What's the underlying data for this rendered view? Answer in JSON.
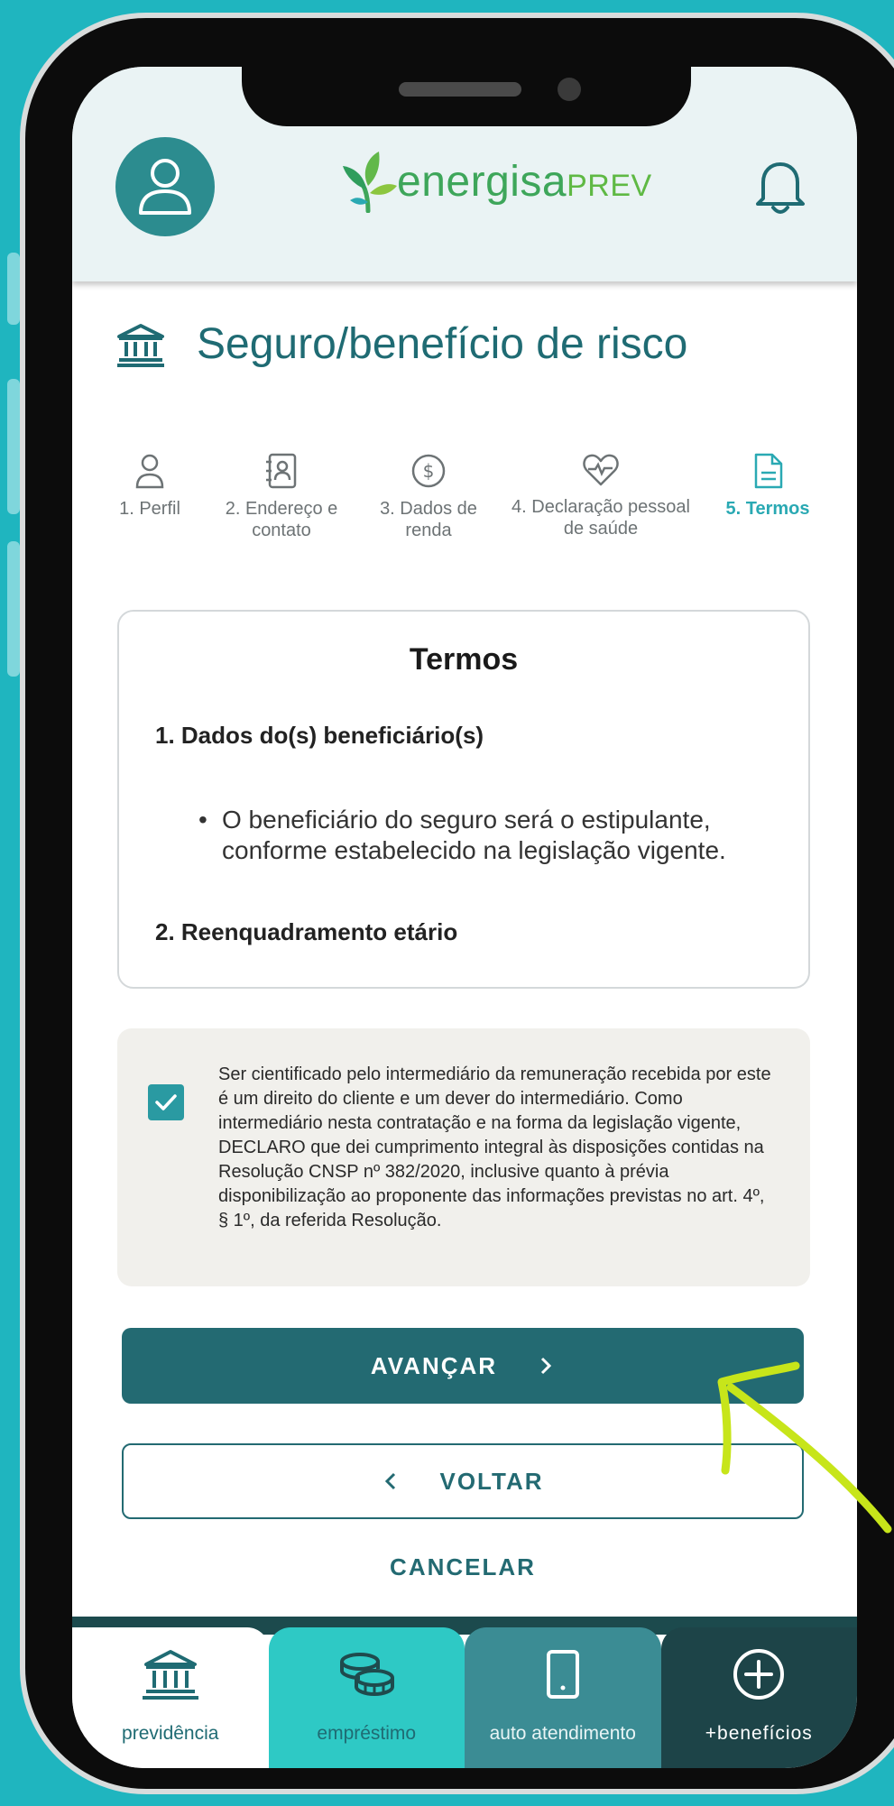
{
  "brand": {
    "logo_prefix": "energisa",
    "logo_suffix": "prev",
    "accent": "#1f6b73",
    "primary_button": "#236a72",
    "highlight_arrow": "#c7e51a"
  },
  "page": {
    "title": "Seguro/benefício de risco"
  },
  "steps": [
    {
      "label": "1. Perfil",
      "icon": "person-icon"
    },
    {
      "label": "2. Endereço e contato",
      "icon": "contact-book-icon"
    },
    {
      "label": "3. Dados de renda",
      "icon": "dollar-coin-icon"
    },
    {
      "label": "4. Declaração pessoal de saúde",
      "icon": "heart-pulse-icon"
    },
    {
      "label": "5. Termos",
      "icon": "document-icon",
      "active": true
    }
  ],
  "terms": {
    "title": "Termos",
    "section1": "1. Dados do(s) beneficiário(s)",
    "bullet1": "O beneficiário do seguro será o estipulante, conforme estabelecido na legislação vigente.",
    "section2": "2. Reenquadramento etário"
  },
  "consent": {
    "checked": true,
    "text": "Ser cientificado pelo intermediário da remuneração recebida por este é um direito do cliente e um dever do intermediário. Como intermediário nesta contratação e na forma da legislação vigente, DECLARO que dei cumprimento integral às disposições contidas na Resolução CNSP nº 382/2020, inclusive quanto à prévia disponibilização ao proponente das informações previstas no art. 4º, § 1º, da referida Resolução."
  },
  "actions": {
    "advance": "AVANÇAR",
    "back": "VOLTAR",
    "cancel": "CANCELAR"
  },
  "tabbar": {
    "items": [
      {
        "label": "previdência",
        "icon": "bank-icon"
      },
      {
        "label": "empréstimo",
        "icon": "coins-icon"
      },
      {
        "label": "auto atendimento",
        "icon": "smartphone-icon"
      },
      {
        "label": "+benefícios",
        "icon": "plus-circle-icon"
      }
    ]
  }
}
